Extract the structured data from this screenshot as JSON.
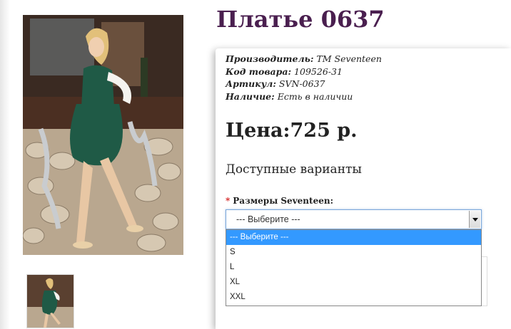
{
  "product": {
    "title": "Платье 0637",
    "manufacturer_label": "Производитель:",
    "manufacturer_value": " TM Seventeen",
    "code_label": "Код товара:",
    "code_value": " 109526-31",
    "sku_label": "Артикул:",
    "sku_value": " SVN-0637",
    "stock_label": "Наличие:",
    "stock_value": " Есть в наличии",
    "price": "Цена:725 р."
  },
  "options": {
    "heading": "Доступные варианты",
    "required_mark": "*",
    "size_label": "Размеры Seventeen:",
    "selected": "--- Выберите ---",
    "items": [
      "--- Выберите ---",
      "S",
      "L",
      "XL",
      "XXL"
    ]
  },
  "colors": {
    "title": "#4a1f4f",
    "required": "#d31f1f",
    "option_highlight": "#3399ff",
    "dress": "#1f5a46"
  }
}
